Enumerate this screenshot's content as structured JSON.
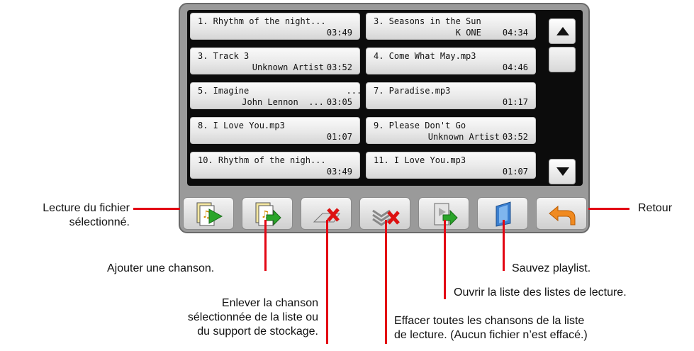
{
  "songs": [
    {
      "title": "1. Rhythm of the night...",
      "artist": "",
      "duration": "03:49"
    },
    {
      "title": "3. Seasons in the Sun",
      "artist": "K ONE",
      "duration": "04:34"
    },
    {
      "title": "3. Track 3",
      "artist": "Unknown Artist",
      "duration": "03:52"
    },
    {
      "title": "4. Come What May.mp3",
      "artist": "",
      "duration": "04:46"
    },
    {
      "title": "5. Imagine                   ...",
      "artist": "John Lennon  ...",
      "duration": "03:05"
    },
    {
      "title": "7. Paradise.mp3",
      "artist": "",
      "duration": "01:17"
    },
    {
      "title": "8. I Love You.mp3",
      "artist": "",
      "duration": "01:07"
    },
    {
      "title": "9. Please Don't Go",
      "artist": "Unknown Artist",
      "duration": "03:52"
    },
    {
      "title": "10. Rhythm of the nigh...",
      "artist": "",
      "duration": "03:49"
    },
    {
      "title": "11. I Love You.mp3",
      "artist": "",
      "duration": "01:07"
    }
  ],
  "toolbar_icons": [
    "play-file-icon",
    "add-song-icon",
    "remove-song-icon",
    "clear-list-icon",
    "open-playlist-icon",
    "save-playlist-icon",
    "back-arrow-icon"
  ],
  "colors": {
    "callout": "#e30613",
    "list_bg": "#0c0c0c",
    "device": "#9a9a9a"
  },
  "callouts": {
    "play": "Lecture du fichier",
    "play2": "sélectionné.",
    "add": "Ajouter une chanson.",
    "remove1": "Enlever la chanson",
    "remove2": "sélectionnée de la liste ou",
    "remove3": "du support de stockage.",
    "clear1": "Effacer toutes les chansons de la liste",
    "clear2": "de lecture. (Aucun fichier n’est effacé.)",
    "open": "Ouvrir la liste des listes de lecture.",
    "save": "Sauvez playlist.",
    "back": "Retour"
  }
}
